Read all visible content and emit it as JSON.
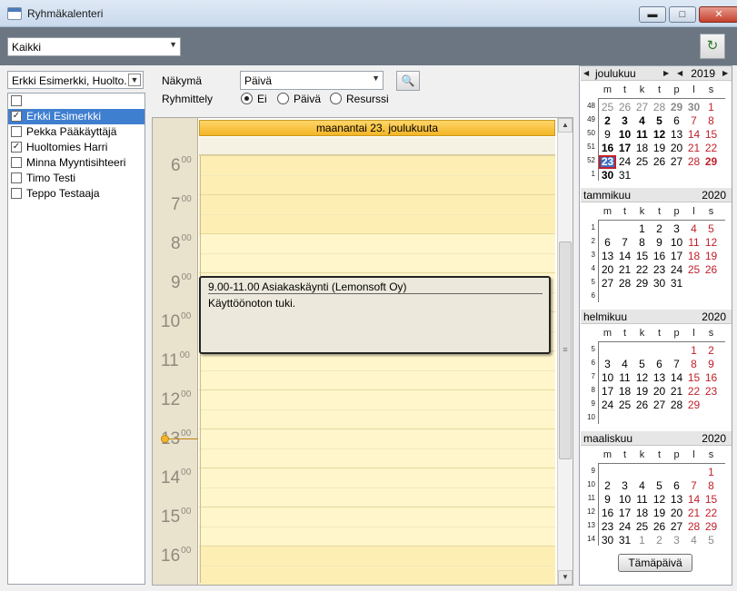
{
  "window": {
    "title": "Ryhmäkalenteri",
    "controls": {
      "minimize": "▬",
      "maximize": "□",
      "close": "✕"
    }
  },
  "toolbar": {
    "filter_value": "Kaikki",
    "refresh_icon": "↻"
  },
  "users": {
    "combo_value": "Erkki Esimerkki, Huolto...",
    "items": [
      {
        "label": "",
        "checked": false,
        "selected": false
      },
      {
        "label": "Erkki Esimerkki",
        "checked": true,
        "selected": true
      },
      {
        "label": "Pekka Pääkäyttäjä",
        "checked": false,
        "selected": false
      },
      {
        "label": "Huoltomies Harri",
        "checked": true,
        "selected": false
      },
      {
        "label": "Minna Myyntisihteeri",
        "checked": false,
        "selected": false
      },
      {
        "label": "Timo Testi",
        "checked": false,
        "selected": false
      },
      {
        "label": "Teppo Testaaja",
        "checked": false,
        "selected": false
      }
    ]
  },
  "view": {
    "nakyma_label": "Näkymä",
    "nakyma_value": "Päivä",
    "ryhmittely_label": "Ryhmittely",
    "radio_ei": "Ei",
    "radio_paiva": "Päivä",
    "radio_resurssi": "Resurssi",
    "selected_grouping": "Ei",
    "print_icon": "🔍"
  },
  "day": {
    "header": "maanantai 23. joulukuuta",
    "hours": [
      {
        "h": "6",
        "m": "00"
      },
      {
        "h": "7",
        "m": "00"
      },
      {
        "h": "8",
        "m": "00"
      },
      {
        "h": "9",
        "m": "00"
      },
      {
        "h": "10",
        "m": "00"
      },
      {
        "h": "11",
        "m": "00"
      },
      {
        "h": "12",
        "m": "00"
      },
      {
        "h": "13",
        "m": "00"
      },
      {
        "h": "14",
        "m": "00"
      },
      {
        "h": "15",
        "m": "00"
      },
      {
        "h": "16",
        "m": "00"
      }
    ],
    "event": {
      "title": "9.00-11.00 Asiakaskäynti (Lemonsoft Oy)",
      "description": "Käyttöönoton tuki."
    }
  },
  "minical": {
    "weekdays": [
      "m",
      "t",
      "k",
      "t",
      "p",
      "l",
      "s"
    ],
    "today_button": "Tämäpäivä",
    "months": [
      {
        "name": "joulukuu",
        "year": "2019",
        "nav": true,
        "weeks": [
          "48",
          "49",
          "50",
          "51",
          "52",
          "1"
        ],
        "days": [
          [
            "25",
            "26",
            "27",
            "28",
            "29",
            "30",
            "1"
          ],
          [
            "2",
            "3",
            "4",
            "5",
            "6",
            "7",
            "8"
          ],
          [
            "9",
            "10",
            "11",
            "12",
            "13",
            "14",
            "15"
          ],
          [
            "16",
            "17",
            "18",
            "19",
            "20",
            "21",
            "22"
          ],
          [
            "23",
            "24",
            "25",
            "26",
            "27",
            "28",
            "29"
          ],
          [
            "30",
            "31",
            "",
            "",
            "",
            "",
            ""
          ]
        ]
      },
      {
        "name": "tammikuu",
        "year": "2020",
        "nav": false,
        "weeks": [
          "1",
          "2",
          "3",
          "4",
          "5",
          "6"
        ],
        "days": [
          [
            "",
            "",
            "1",
            "2",
            "3",
            "4",
            "5"
          ],
          [
            "6",
            "7",
            "8",
            "9",
            "10",
            "11",
            "12"
          ],
          [
            "13",
            "14",
            "15",
            "16",
            "17",
            "18",
            "19"
          ],
          [
            "20",
            "21",
            "22",
            "23",
            "24",
            "25",
            "26"
          ],
          [
            "27",
            "28",
            "29",
            "30",
            "31",
            "",
            ""
          ],
          [
            "",
            "",
            "",
            "",
            "",
            "",
            ""
          ]
        ]
      },
      {
        "name": "helmikuu",
        "year": "2020",
        "nav": false,
        "weeks": [
          "5",
          "6",
          "7",
          "8",
          "9",
          "10"
        ],
        "days": [
          [
            "",
            "",
            "",
            "",
            "",
            "1",
            "2"
          ],
          [
            "3",
            "4",
            "5",
            "6",
            "7",
            "8",
            "9"
          ],
          [
            "10",
            "11",
            "12",
            "13",
            "14",
            "15",
            "16"
          ],
          [
            "17",
            "18",
            "19",
            "20",
            "21",
            "22",
            "23"
          ],
          [
            "24",
            "25",
            "26",
            "27",
            "28",
            "29",
            ""
          ],
          [
            "",
            "",
            "",
            "",
            "",
            "",
            ""
          ]
        ]
      },
      {
        "name": "maaliskuu",
        "year": "2020",
        "nav": false,
        "weeks": [
          "9",
          "10",
          "11",
          "12",
          "13",
          "14"
        ],
        "days": [
          [
            "",
            "",
            "",
            "",
            "",
            "",
            "1"
          ],
          [
            "2",
            "3",
            "4",
            "5",
            "6",
            "7",
            "8"
          ],
          [
            "9",
            "10",
            "11",
            "12",
            "13",
            "14",
            "15"
          ],
          [
            "16",
            "17",
            "18",
            "19",
            "20",
            "21",
            "22"
          ],
          [
            "23",
            "24",
            "25",
            "26",
            "27",
            "28",
            "29"
          ],
          [
            "30",
            "31",
            "1",
            "2",
            "3",
            "4",
            "5"
          ]
        ]
      }
    ]
  }
}
